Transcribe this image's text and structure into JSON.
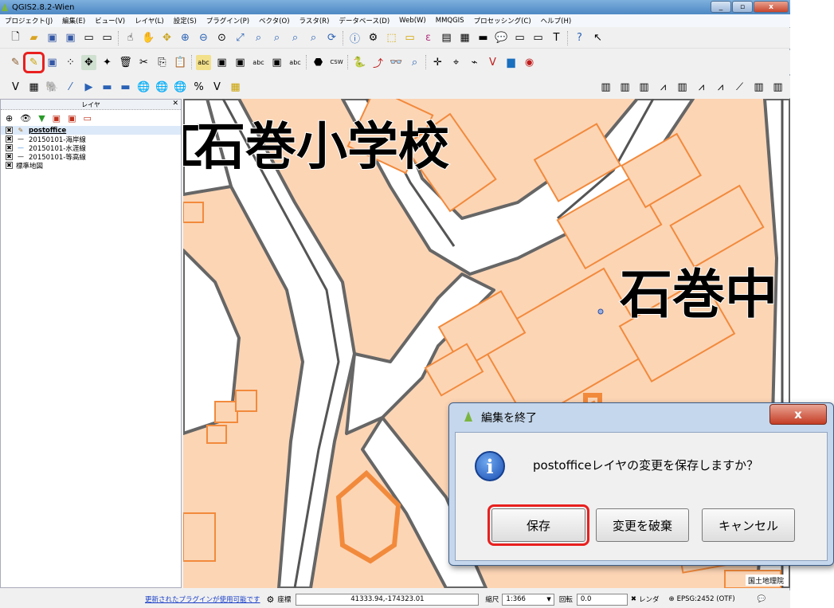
{
  "window": {
    "title": "QGIS2.8.2-Wien",
    "buttons": {
      "min": "_",
      "max": "▫",
      "close": "x"
    }
  },
  "menu": [
    "プロジェクト(J)",
    "編集(E)",
    "ビュー(V)",
    "レイヤ(L)",
    "設定(S)",
    "プラグイン(P)",
    "ベクタ(O)",
    "ラスタ(R)",
    "データベース(D)",
    "Web(W)",
    "MMQGIS",
    "プロセッシング(C)",
    "ヘルプ(H)"
  ],
  "layers_panel": {
    "title": "レイヤ",
    "close": "✕",
    "items": [
      {
        "name": "postoffice",
        "checked": "✖",
        "icon": "✎",
        "selected": true
      },
      {
        "name": "20150101-海岸線",
        "checked": "✖",
        "icon": "—"
      },
      {
        "name": "20150101-水涯線",
        "checked": "✖",
        "icon": "—"
      },
      {
        "name": "20150101-等高線",
        "checked": "✖",
        "icon": "—"
      },
      {
        "name": "標準地図",
        "checked": "✖",
        "icon": ""
      }
    ]
  },
  "map": {
    "labels": [
      "石巻小学校",
      "石巻中"
    ],
    "attribution": "国土地理院",
    "label_left_partial": "江"
  },
  "status": {
    "plugins_link": "更新されたプラグインが使用可能です",
    "coord_label": "座標",
    "coord_value": "41333.94,-174323.01",
    "scale_label": "縮尺",
    "scale_value": "1:366",
    "rotation_label": "回転",
    "rotation_value": "0.0",
    "render_label": "レンダ",
    "crs": "EPSG:2452 (OTF)"
  },
  "dialog": {
    "title": "編集を終了",
    "close": "x",
    "info_glyph": "i",
    "message": "postofficeレイヤの変更を保存しますか？",
    "buttons": {
      "save": "保存",
      "discard": "変更を破棄",
      "cancel": "キャンセル"
    }
  },
  "colors": {
    "building_fill": "#fcd5b5",
    "building_edge": "#f28a3c",
    "road_edge": "#555555",
    "highlight": "#e8201f"
  }
}
